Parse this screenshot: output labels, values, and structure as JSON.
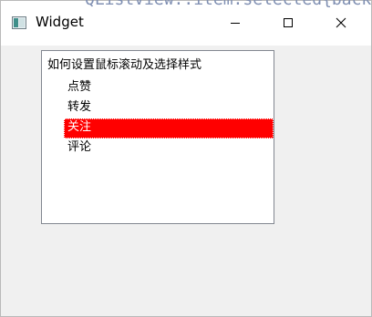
{
  "background_text": "QListView::item:selected{background",
  "window": {
    "title": "Widget"
  },
  "list": {
    "header": "如何设置鼠标滚动及选择样式",
    "items": [
      {
        "label": "点赞"
      },
      {
        "label": "转发"
      },
      {
        "label": "关注"
      },
      {
        "label": "评论"
      }
    ],
    "selected_index": 2
  },
  "colors": {
    "selection_background": "#ff0000",
    "selection_text": "#ffffff",
    "window_background": "#f0f0f0"
  },
  "icons": {
    "app": "app-window-icon",
    "minimize": "minimize-icon",
    "maximize": "maximize-icon",
    "close": "close-icon"
  }
}
